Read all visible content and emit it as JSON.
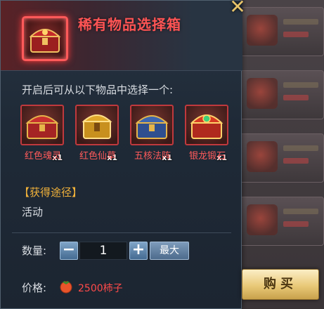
{
  "header": {
    "title": "稀有物品选择箱",
    "close_symbol": "✕"
  },
  "description": "开启后可从以下物品中选择一个:",
  "items": [
    {
      "name": "红色魂灵",
      "count": "x1",
      "icon": "red-chest-icon"
    },
    {
      "name": "红色仙草",
      "count": "x1",
      "icon": "golden-chest-icon"
    },
    {
      "name": "五核法阵",
      "count": "x1",
      "icon": "blue-chest-icon"
    },
    {
      "name": "银龙锻石",
      "count": "x1",
      "icon": "red-gold-chest-icon"
    }
  ],
  "source": {
    "title": "【获得途径】",
    "value": "活动"
  },
  "quantity": {
    "label": "数量:",
    "value": "1",
    "minus": "−",
    "plus": "+",
    "max_label": "最大"
  },
  "price": {
    "label": "价格:",
    "value": "2500柿子",
    "icon": "persimmon-icon"
  },
  "buy_label": "购买",
  "colors": {
    "title": "#ff5454",
    "item_label": "#ff5a5a",
    "source_title": "#f0b13a",
    "price": "#ff4a4a",
    "buy_bg": "#e9c978"
  }
}
